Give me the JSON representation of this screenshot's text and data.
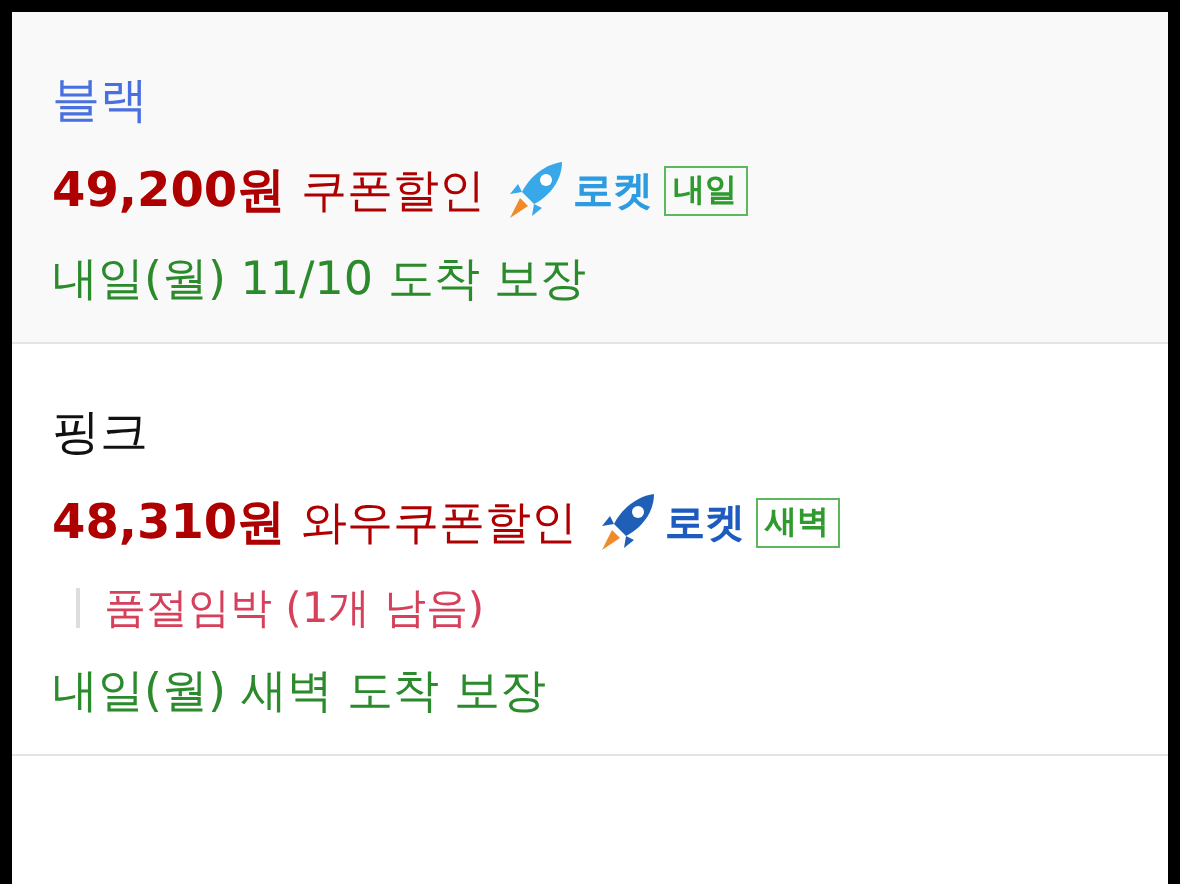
{
  "options": [
    {
      "name": "블랙",
      "selected": true,
      "price": "49,200원",
      "discount": "쿠폰할인",
      "rocket": {
        "label": "로켓",
        "tag": "내일"
      },
      "delivery": "내일(월) 11/10 도착 보장"
    },
    {
      "name": "핑크",
      "selected": false,
      "price": "48,310원",
      "discount": "와우쿠폰할인",
      "rocket": {
        "label": "로켓",
        "tag": "새벽"
      },
      "stock": "품절임박 (1개 남음)",
      "delivery": "내일(월) 새벽 도착 보장"
    }
  ]
}
